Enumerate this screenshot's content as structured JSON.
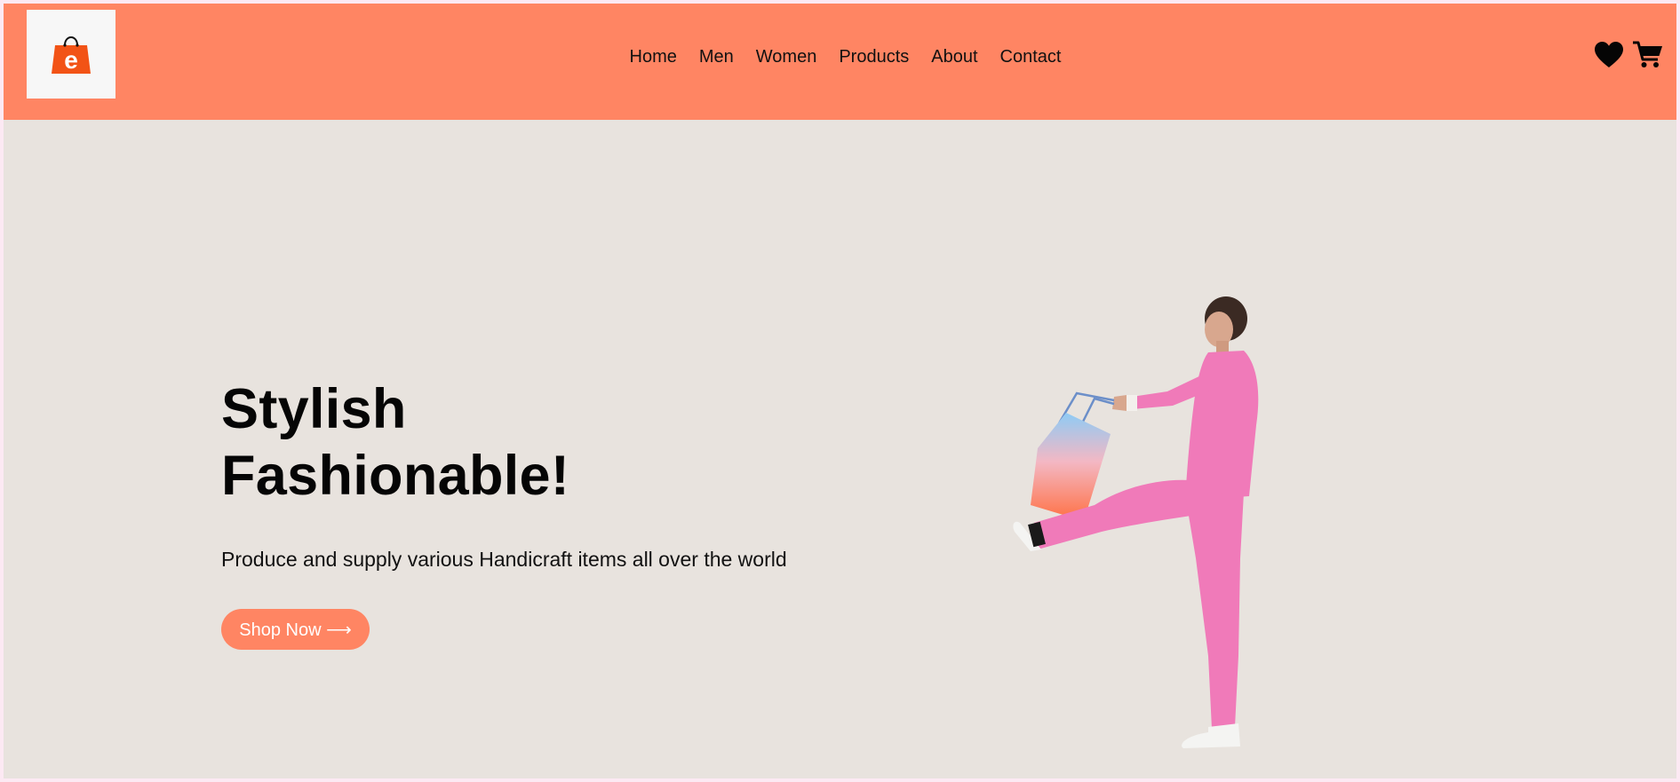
{
  "header": {
    "logo_icon": "shopping-bag-e-icon",
    "logo_letter": "e",
    "nav": [
      {
        "label": "Home"
      },
      {
        "label": "Men"
      },
      {
        "label": "Women"
      },
      {
        "label": "Products"
      },
      {
        "label": "About"
      },
      {
        "label": "Contact"
      }
    ],
    "icons": [
      "heart-icon",
      "cart-icon"
    ]
  },
  "hero": {
    "title_line1": "Stylish",
    "title_line2": "Fashionable!",
    "subtitle": "Produce and supply various Handicraft items all over the world",
    "cta_label": "Shop Now ⟶",
    "image": "woman-in-pink-suit-with-shopping-bag"
  },
  "colors": {
    "accent": "#ff8563",
    "background": "#e8e3de",
    "logo_bag": "#f25316",
    "suit": "#f07ab9"
  }
}
